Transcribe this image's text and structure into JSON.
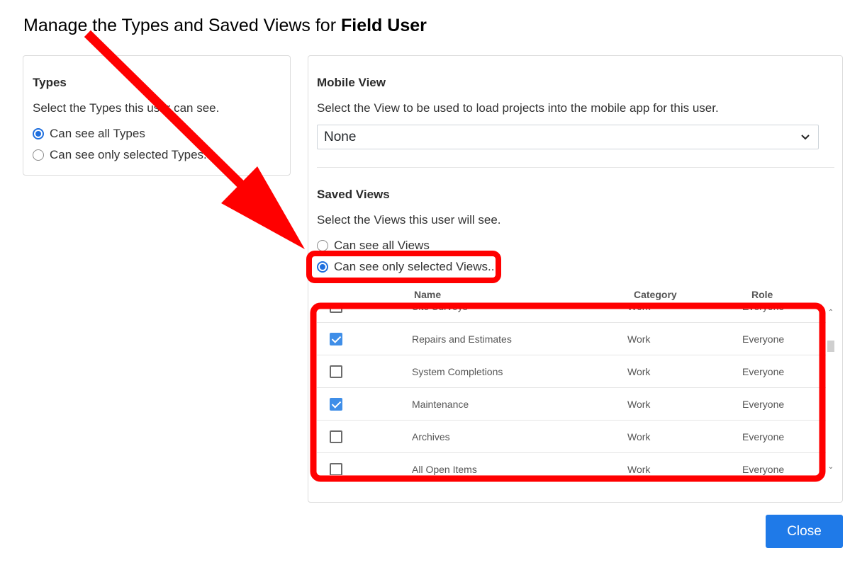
{
  "dialog": {
    "title_prefix": "Manage the Types and Saved Views for ",
    "title_user": "Field User"
  },
  "types": {
    "heading": "Types",
    "description": "Select the Types this user can see.",
    "options": [
      {
        "label": "Can see all Types",
        "checked": true
      },
      {
        "label": "Can see only selected Types...",
        "checked": false
      }
    ]
  },
  "mobile_view": {
    "heading": "Mobile View",
    "description": "Select the View to be used to load projects into the mobile app for this user.",
    "selected": "None"
  },
  "saved_views": {
    "heading": "Saved Views",
    "description": "Select the Views this user will see.",
    "options": [
      {
        "label": "Can see all Views",
        "checked": false
      },
      {
        "label": "Can see only selected Views...",
        "checked": true
      }
    ],
    "columns": {
      "name": "Name",
      "category": "Category",
      "role": "Role"
    },
    "rows": [
      {
        "name": "Site Surveys",
        "category": "Work",
        "role": "Everyone",
        "checked": false
      },
      {
        "name": "Repairs and Estimates",
        "category": "Work",
        "role": "Everyone",
        "checked": true
      },
      {
        "name": "System Completions",
        "category": "Work",
        "role": "Everyone",
        "checked": false
      },
      {
        "name": "Maintenance",
        "category": "Work",
        "role": "Everyone",
        "checked": true
      },
      {
        "name": "Archives",
        "category": "Work",
        "role": "Everyone",
        "checked": false
      },
      {
        "name": "All Open Items",
        "category": "Work",
        "role": "Everyone",
        "checked": false
      }
    ]
  },
  "footer": {
    "close_label": "Close"
  },
  "annotation": {
    "color": "#ff0000"
  },
  "icons": {
    "select_chevron": "chevron-down-icon",
    "scroll_up": "chevron-up-icon",
    "scroll_down": "chevron-down-icon"
  }
}
